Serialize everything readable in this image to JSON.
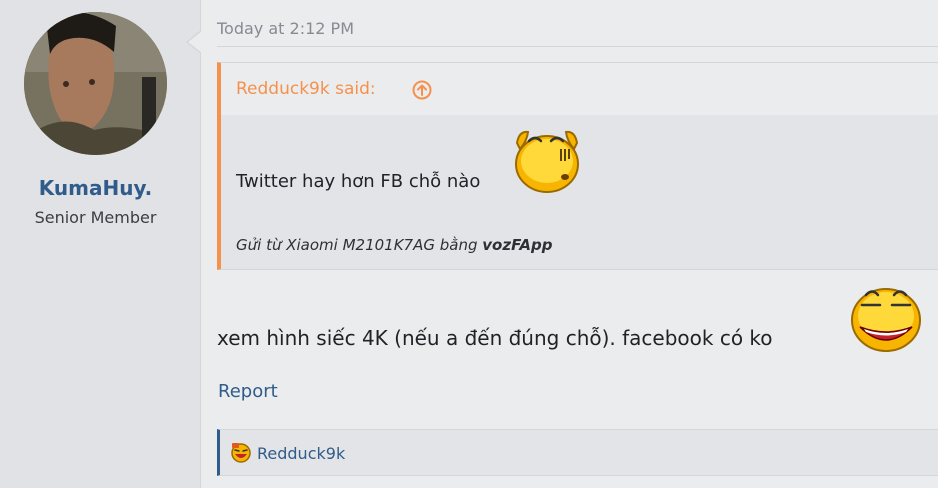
{
  "user": {
    "username": "KumaHuy.",
    "title": "Senior Member"
  },
  "post": {
    "date": "Today at 2:12 PM",
    "quote": {
      "author_line": "Redduck9k said:",
      "text": "Twitter hay hơn FB chỗ nào",
      "signature_prefix": "Gửi từ Xiaomi M2101K7AG bằng",
      "signature_app": "vozFApp"
    },
    "message": "xem hình siếc 4K (nếu a đến đúng chỗ). facebook có ko",
    "report_label": "Report",
    "reactions": {
      "user": "Redduck9k"
    }
  },
  "icons": {
    "quote_jump": "arrow-up-circle-icon",
    "emoji_1": "thinking-smiley-icon",
    "emoji_2": "grinning-smiley-icon",
    "reaction": "haha-reaction-icon"
  },
  "colors": {
    "accent_orange": "#f5914c",
    "link_blue": "#2f5c8a"
  }
}
